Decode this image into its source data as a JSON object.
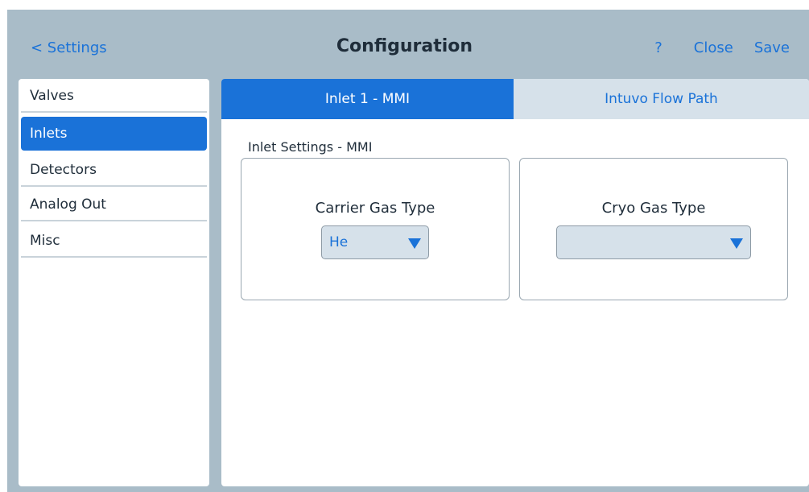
{
  "header": {
    "back_label": "< Settings",
    "title": "Configuration",
    "help_label": "?",
    "close_label": "Close",
    "save_label": "Save"
  },
  "sidebar": {
    "items": [
      {
        "label": "Valves",
        "active": false
      },
      {
        "label": "Inlets",
        "active": true
      },
      {
        "label": "Detectors",
        "active": false
      },
      {
        "label": "Analog Out",
        "active": false
      },
      {
        "label": "Misc",
        "active": false
      }
    ]
  },
  "tabs": [
    {
      "label": "Inlet 1 - MMI",
      "active": true
    },
    {
      "label": "Intuvo Flow Path",
      "active": false
    }
  ],
  "inlet_settings": {
    "section_title": "Inlet Settings - MMI",
    "carrier_gas": {
      "label": "Carrier Gas Type",
      "value": "He"
    },
    "cryo_gas": {
      "label": "Cryo Gas Type",
      "value": ""
    }
  },
  "colors": {
    "accent": "#1a72d8",
    "app_background": "#a9bcc8",
    "inactive_tab": "#d6e1ea",
    "text": "#1f2d3a"
  },
  "icons": {
    "dropdown_arrow": "triangle-down-icon"
  }
}
